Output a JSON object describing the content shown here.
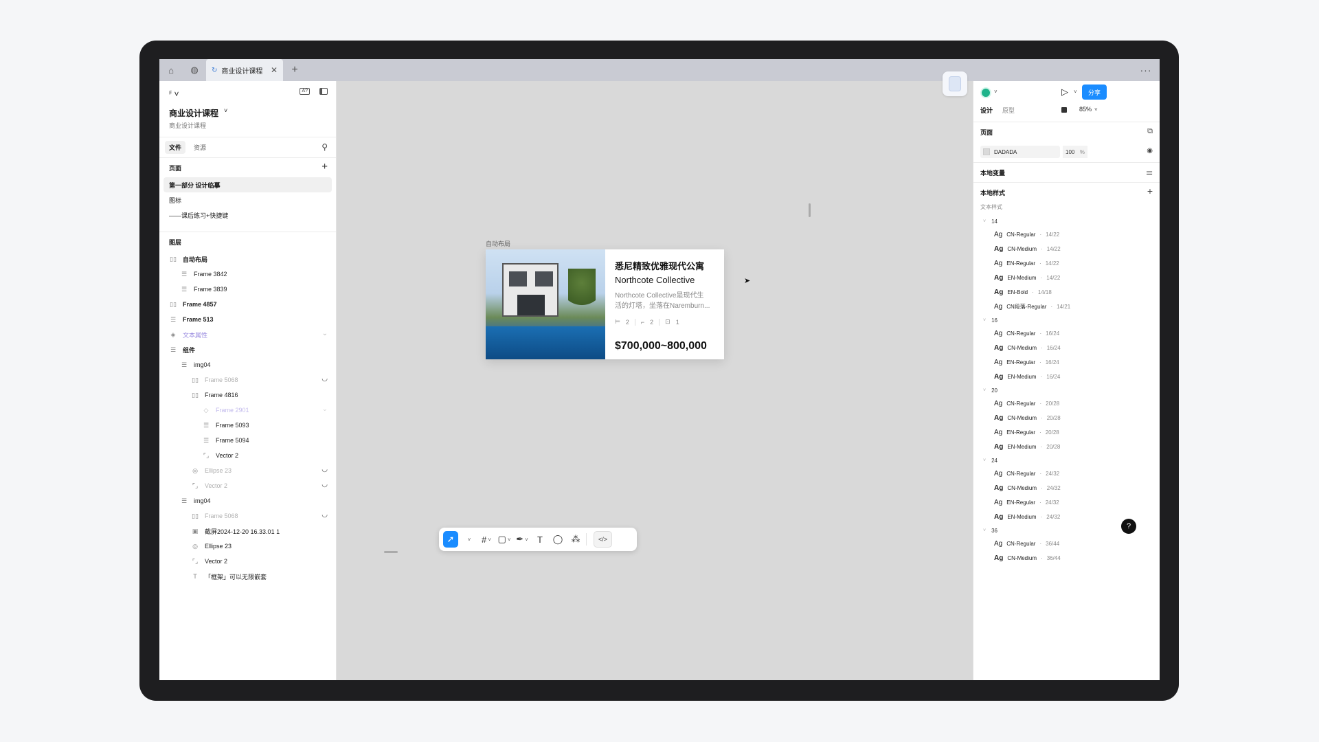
{
  "browser": {
    "tab_title": "商业设计课程",
    "close_glyph": "✕",
    "plus_glyph": "+",
    "more_glyph": "···",
    "home_icon": "⌂",
    "globe_icon": "◍",
    "tab_icon": "↻"
  },
  "left_panel": {
    "logo_glyph": "ꟳ ˅",
    "project_title": "商业设计课程",
    "project_caret": "˅",
    "project_subtitle": "商业设计课程",
    "tabs": [
      "文件",
      "资源"
    ],
    "pages_header": "页面",
    "pages": [
      "第一部分 设计临摹",
      "图标",
      "——课后练习+快捷键"
    ],
    "layers_header": "图层",
    "layers": [
      {
        "label": "自动布局",
        "icon": "▯▯",
        "indent": 0,
        "style": "bold"
      },
      {
        "label": "Frame 3842",
        "icon": "☰",
        "indent": 1,
        "style": ""
      },
      {
        "label": "Frame 3839",
        "icon": "☰",
        "indent": 1,
        "style": ""
      },
      {
        "label": "Frame 4857",
        "icon": "▯▯",
        "indent": 0,
        "style": "bold"
      },
      {
        "label": "Frame 513",
        "icon": "☰",
        "indent": 0,
        "style": "bold"
      },
      {
        "label": "文本属性",
        "icon": "◈",
        "indent": 0,
        "style": "purple",
        "right": "⌄"
      },
      {
        "label": "组件",
        "icon": "☰",
        "indent": 0,
        "style": "bold"
      },
      {
        "label": "img04",
        "icon": "☰",
        "indent": 1,
        "style": ""
      },
      {
        "label": "Frame 5068",
        "icon": "▯▯",
        "indent": 2,
        "style": "dim",
        "right": "◡"
      },
      {
        "label": "Frame 4816",
        "icon": "▯▯",
        "indent": 2,
        "style": ""
      },
      {
        "label": "Frame 2901",
        "icon": "◇",
        "indent": 3,
        "style": "purple-dim",
        "right": "⌄"
      },
      {
        "label": "Frame 5093",
        "icon": "☰",
        "indent": 3,
        "style": ""
      },
      {
        "label": "Frame 5094",
        "icon": "☰",
        "indent": 3,
        "style": ""
      },
      {
        "label": "Vector 2",
        "icon": "⌜⌟",
        "indent": 3,
        "style": ""
      },
      {
        "label": "Ellipse 23",
        "icon": "◎",
        "indent": 2,
        "style": "dim",
        "right": "◡"
      },
      {
        "label": "Vector 2",
        "icon": "⌜⌟",
        "indent": 2,
        "style": "dim",
        "right": "◡"
      },
      {
        "label": "img04",
        "icon": "☰",
        "indent": 1,
        "style": ""
      },
      {
        "label": "Frame 5068",
        "icon": "▯▯",
        "indent": 2,
        "style": "dim",
        "right": "◡"
      },
      {
        "label": "截屏2024-12-20 16.33.01 1",
        "icon": "▣",
        "indent": 2,
        "style": ""
      },
      {
        "label": "Ellipse 23",
        "icon": "◎",
        "indent": 2,
        "style": ""
      },
      {
        "label": "Vector 2",
        "icon": "⌜⌟",
        "indent": 2,
        "style": ""
      },
      {
        "label": "「框架」可以无限嵌套",
        "icon": "T",
        "indent": 2,
        "style": ""
      }
    ]
  },
  "canvas": {
    "frame_label": "自动布局",
    "card": {
      "title_cn": "悉尼精致优雅现代公寓",
      "title_en": "Northcote Collective",
      "desc_line1": "Northcote Collective是现代生",
      "desc_line2": "活的灯塔，坐落在Naremburn...",
      "beds": "2",
      "baths": "2",
      "parking": "1",
      "price": "$700,000~800,000"
    }
  },
  "toolbar": {
    "tools": [
      "move",
      "frame",
      "rectangle",
      "pen",
      "text",
      "comment",
      "components"
    ],
    "code_label": "</>"
  },
  "right_panel": {
    "share_label": "分享",
    "tabs": [
      "设计",
      "原型"
    ],
    "zoom": "85%",
    "page_section": "页面",
    "fill_hex": "DADADA",
    "fill_opacity": "100",
    "fill_pct": "%",
    "local_variables": "本地变量",
    "local_styles": "本地样式",
    "text_styles_label": "文本样式",
    "groups": [
      {
        "size": "14",
        "styles": [
          {
            "name": "CN-Regular",
            "spec": "14/22"
          },
          {
            "name": "CN-Medium",
            "spec": "14/22"
          },
          {
            "name": "EN-Regular",
            "spec": "14/22"
          },
          {
            "name": "EN-Medium",
            "spec": "14/22"
          },
          {
            "name": "EN-Bold",
            "spec": "14/18"
          },
          {
            "name": "CN段落-Regular",
            "spec": "14/21"
          }
        ]
      },
      {
        "size": "16",
        "styles": [
          {
            "name": "CN-Regular",
            "spec": "16/24"
          },
          {
            "name": "CN-Medium",
            "spec": "16/24"
          },
          {
            "name": "EN-Regular",
            "spec": "16/24"
          },
          {
            "name": "EN-Medium",
            "spec": "16/24"
          }
        ]
      },
      {
        "size": "20",
        "styles": [
          {
            "name": "CN-Regular",
            "spec": "20/28"
          },
          {
            "name": "CN-Medium",
            "spec": "20/28"
          },
          {
            "name": "EN-Regular",
            "spec": "20/28"
          },
          {
            "name": "EN-Medium",
            "spec": "20/28"
          }
        ]
      },
      {
        "size": "24",
        "styles": [
          {
            "name": "CN-Regular",
            "spec": "24/32"
          },
          {
            "name": "CN-Medium",
            "spec": "24/32"
          },
          {
            "name": "EN-Regular",
            "spec": "24/32"
          },
          {
            "name": "EN-Medium",
            "spec": "24/32"
          }
        ]
      },
      {
        "size": "36",
        "styles": [
          {
            "name": "CN-Regular",
            "spec": "36/44"
          },
          {
            "name": "CN-Medium",
            "spec": "36/44"
          }
        ]
      }
    ],
    "help_label": "?"
  },
  "colors": {
    "accent": "#1a8cff",
    "canvas": "#d9d9d9",
    "device_frame": "#1e1e20"
  }
}
